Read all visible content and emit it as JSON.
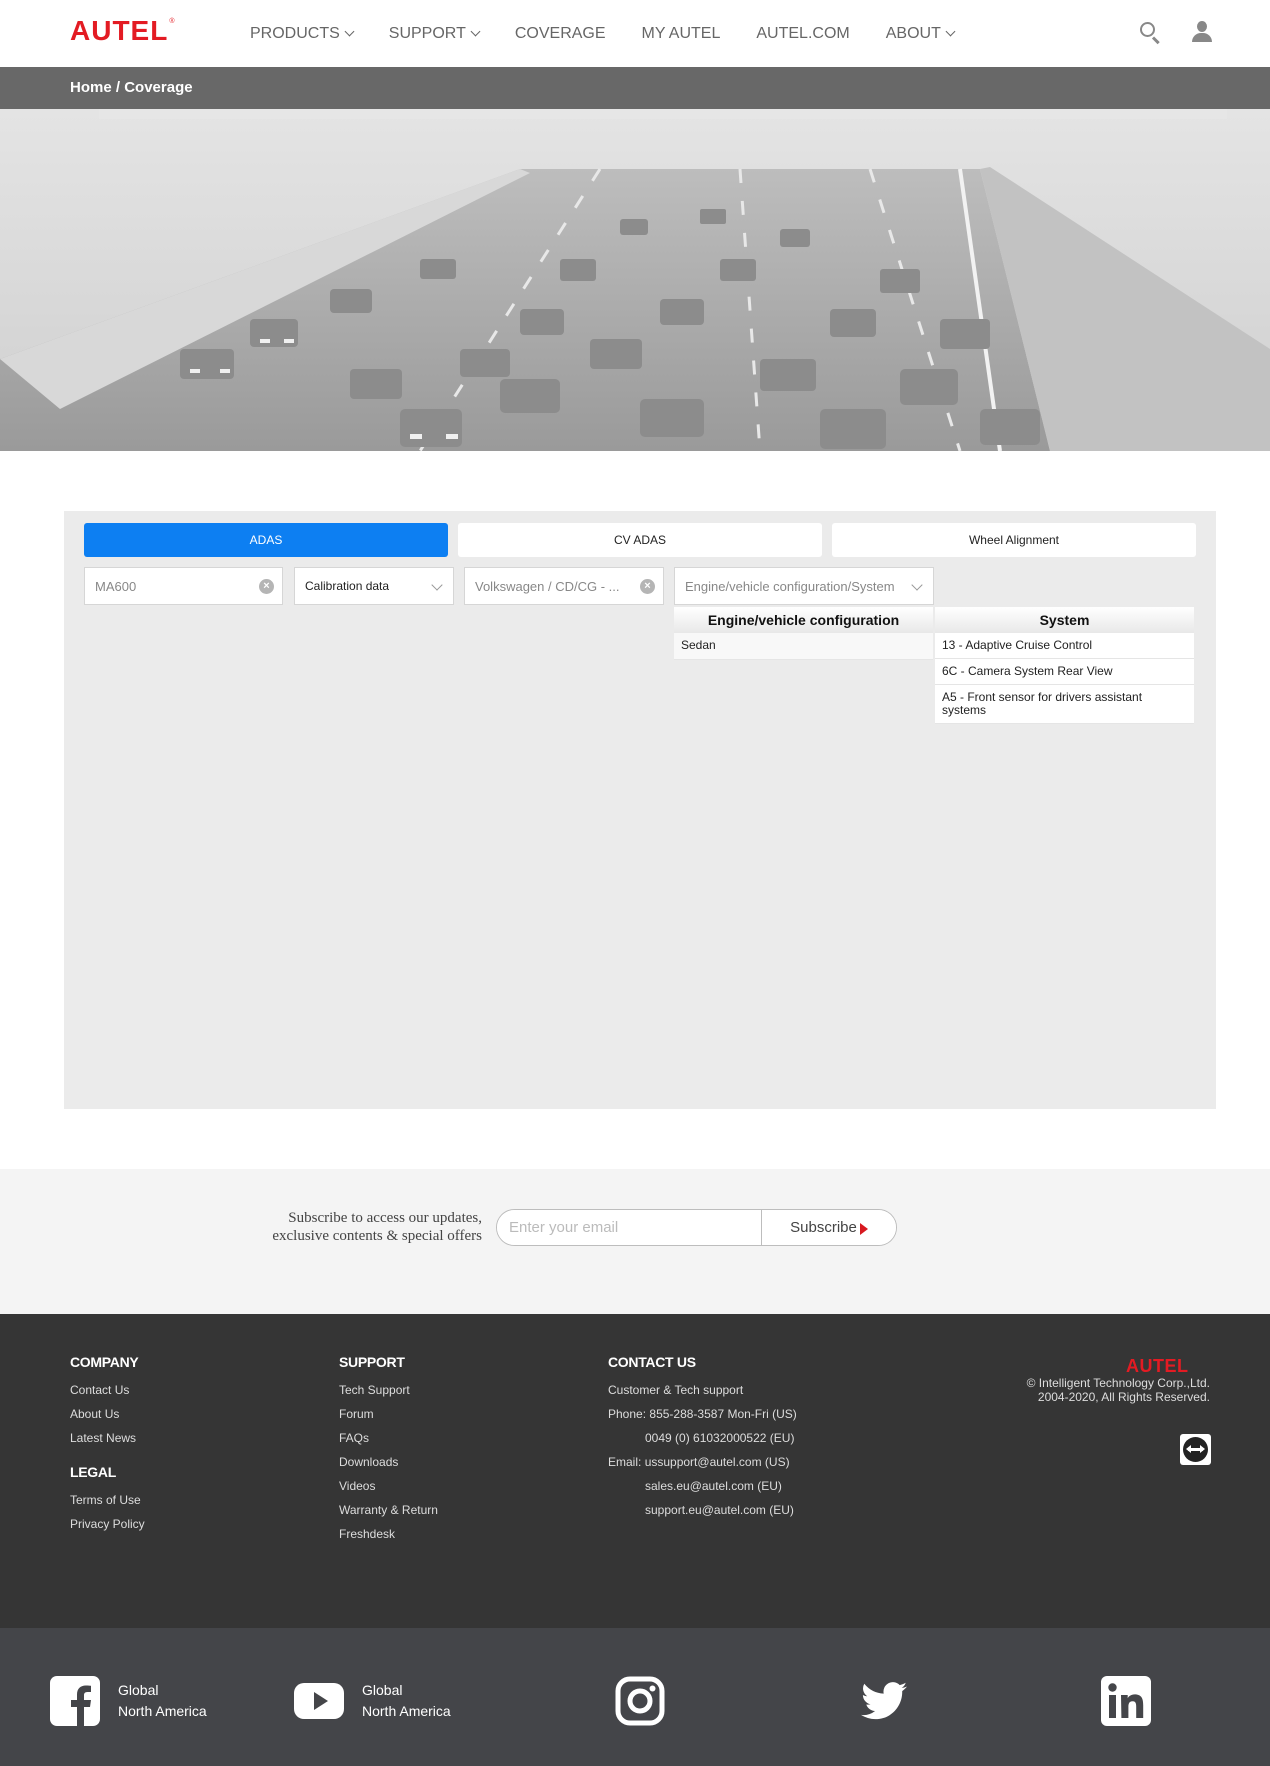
{
  "header": {
    "logo": "AUTEL",
    "logo_mark": "®",
    "nav": [
      {
        "label": "PRODUCTS",
        "dropdown": true
      },
      {
        "label": "SUPPORT",
        "dropdown": true
      },
      {
        "label": "COVERAGE",
        "dropdown": false
      },
      {
        "label": "MY AUTEL",
        "dropdown": false
      },
      {
        "label": "AUTEL.COM",
        "dropdown": false
      },
      {
        "label": "ABOUT",
        "dropdown": true
      }
    ],
    "icons": [
      "search-icon",
      "user-icon"
    ]
  },
  "breadcrumb": {
    "home": "Home",
    "separator": " / ",
    "current": "Coverage"
  },
  "coverage": {
    "tabs": [
      {
        "label": "ADAS",
        "active": true
      },
      {
        "label": "CV ADAS",
        "active": false
      },
      {
        "label": "Wheel Alignment",
        "active": false
      }
    ],
    "filters": {
      "product": "MA600",
      "data_type": "Calibration data",
      "vehicle": "Volkswagen / CD/CG - ...",
      "config_placeholder": "Engine/vehicle configuration/System"
    },
    "dropdown": {
      "config_header": "Engine/vehicle configuration",
      "system_header": "System",
      "configs": [
        "Sedan"
      ],
      "systems": [
        "13 - Adaptive Cruise Control",
        "6C - Camera System Rear View",
        "A5 - Front sensor for drivers assistant systems"
      ]
    }
  },
  "subscribe": {
    "text_line1": "Subscribe to access our updates,",
    "text_line2": "exclusive contents & special offers",
    "placeholder": "Enter your email",
    "button": "Subscribe"
  },
  "footer": {
    "company": {
      "title": "COMPANY",
      "links": [
        "Contact Us",
        "About Us",
        "Latest News"
      ]
    },
    "legal": {
      "title": "LEGAL",
      "links": [
        "Terms of Use",
        "Privacy Policy"
      ]
    },
    "support": {
      "title": "SUPPORT",
      "links": [
        "Tech Support",
        "Forum",
        "FAQs",
        "Downloads",
        "Videos",
        "Warranty & Return",
        "Freshdesk"
      ]
    },
    "contact": {
      "title": "CONTACT US",
      "line1": "Customer & Tech support",
      "phone_label": "Phone:",
      "phone_us": "855-288-3587 Mon-Fri (US)",
      "phone_eu": "0049 (0) 61032000522 (EU)",
      "email_label": "Email:",
      "email_us": "ussupport@autel.com (US)",
      "email_sales": "sales.eu@autel.com (EU)",
      "email_support": "support.eu@autel.com (EU)"
    },
    "logo": "AUTEL",
    "copyright_line1": "© Intelligent Technology Corp.,Ltd.",
    "copyright_line2": "2004-2020, All Rights Reserved."
  },
  "social": {
    "facebook": {
      "link1": "Global",
      "link2": "North America"
    },
    "youtube": {
      "link1": "Global",
      "link2": "North America"
    },
    "icons": [
      "facebook-icon",
      "youtube-icon",
      "instagram-icon",
      "twitter-icon",
      "linkedin-icon"
    ]
  },
  "colors": {
    "brand_red": "#e31b23",
    "active_tab": "#0d7ff2",
    "breadcrumb_bar": "#686868",
    "footer_bg": "#353535",
    "social_bg": "#444549"
  }
}
